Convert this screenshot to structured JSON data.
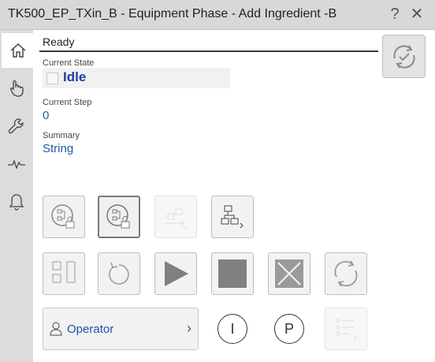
{
  "window": {
    "title": "TK500_EP_TXin_B - Equipment Phase - Add Ingredient -B",
    "help_glyph": "?",
    "close_glyph": "✕"
  },
  "nav": {
    "items": [
      {
        "name": "home",
        "icon": "home-icon",
        "active": true
      },
      {
        "name": "hand",
        "icon": "hand-pointer-icon"
      },
      {
        "name": "wrench",
        "icon": "wrench-icon"
      },
      {
        "name": "trend",
        "icon": "heartbeat-icon"
      },
      {
        "name": "alarms",
        "icon": "bell-icon"
      }
    ]
  },
  "status": {
    "text": "Ready"
  },
  "fields": {
    "current_state_label": "Current State",
    "current_state_value": "Idle",
    "current_step_label": "Current Step",
    "current_step_value": "0",
    "summary_label": "Summary",
    "summary_value": "String"
  },
  "operator": {
    "label": "Operator",
    "chevron": "›"
  },
  "mode_buttons": {
    "i_label": "I",
    "p_label": "P"
  },
  "colors": {
    "accent_blue": "#1f5aa8",
    "state_blue": "#1f3f9c",
    "titlebar": "#d8d8d8",
    "nav": "#dcdcdc"
  }
}
